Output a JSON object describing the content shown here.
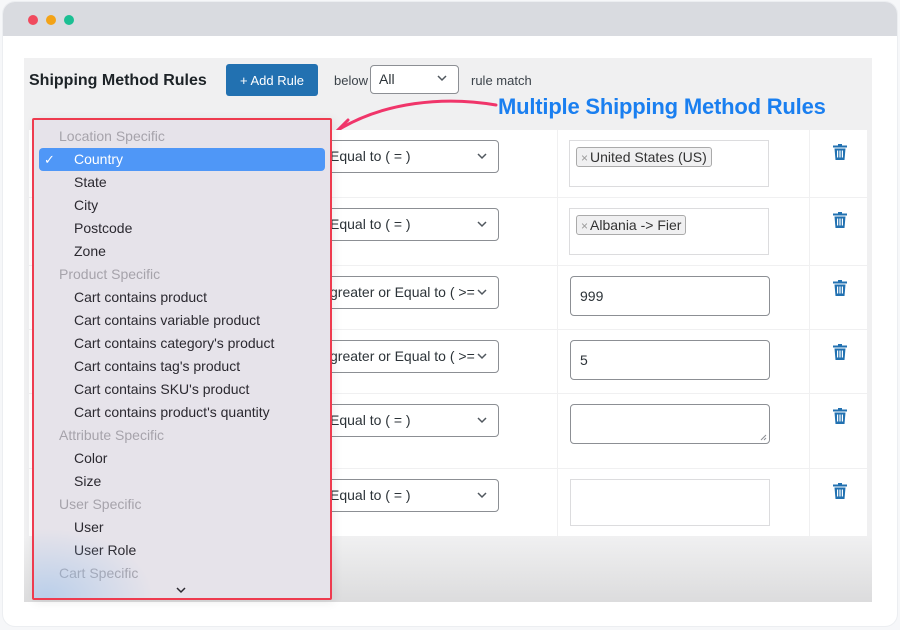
{
  "window": {
    "controls": [
      "close",
      "minimize",
      "maximize"
    ]
  },
  "header": {
    "title": "Shipping Method Rules",
    "add_rule_label": "+ Add Rule",
    "below_label": "below",
    "match_select_value": "All",
    "rule_match_label": "rule match"
  },
  "annotation": {
    "text": "Multiple Shipping Method Rules",
    "color": "#1a7ff0",
    "arrow_color": "#f0356a"
  },
  "rules": [
    {
      "operator": "Equal to ( = )",
      "value_type": "tags",
      "tags": [
        "United States (US)"
      ]
    },
    {
      "operator": "Equal to ( = )",
      "value_type": "tags",
      "tags": [
        "Albania -> Fier"
      ]
    },
    {
      "operator": "greater or Equal to ( >=",
      "value_type": "input",
      "value": "999"
    },
    {
      "operator": "greater or Equal to ( >=",
      "value_type": "input",
      "value": "5"
    },
    {
      "operator": "Equal to ( = )",
      "value_type": "textarea",
      "value": ""
    },
    {
      "operator": "Equal to ( = )",
      "value_type": "empty",
      "value": ""
    }
  ],
  "dropdown": {
    "groups": [
      {
        "label": "Location Specific",
        "items": [
          "Country",
          "State",
          "City",
          "Postcode",
          "Zone"
        ]
      },
      {
        "label": "Product Specific",
        "items": [
          "Cart contains product",
          "Cart contains variable product",
          "Cart contains category's product",
          "Cart contains tag's product",
          "Cart contains SKU's product",
          "Cart contains product's quantity"
        ]
      },
      {
        "label": "Attribute Specific",
        "items": [
          "Color",
          "Size"
        ]
      },
      {
        "label": "User Specific",
        "items": [
          "User",
          "User Role"
        ]
      },
      {
        "label": "Cart Specific",
        "items": []
      }
    ],
    "selected": "Country",
    "highlight_color": "#4f97f7",
    "border_color": "#ee3b4f"
  }
}
